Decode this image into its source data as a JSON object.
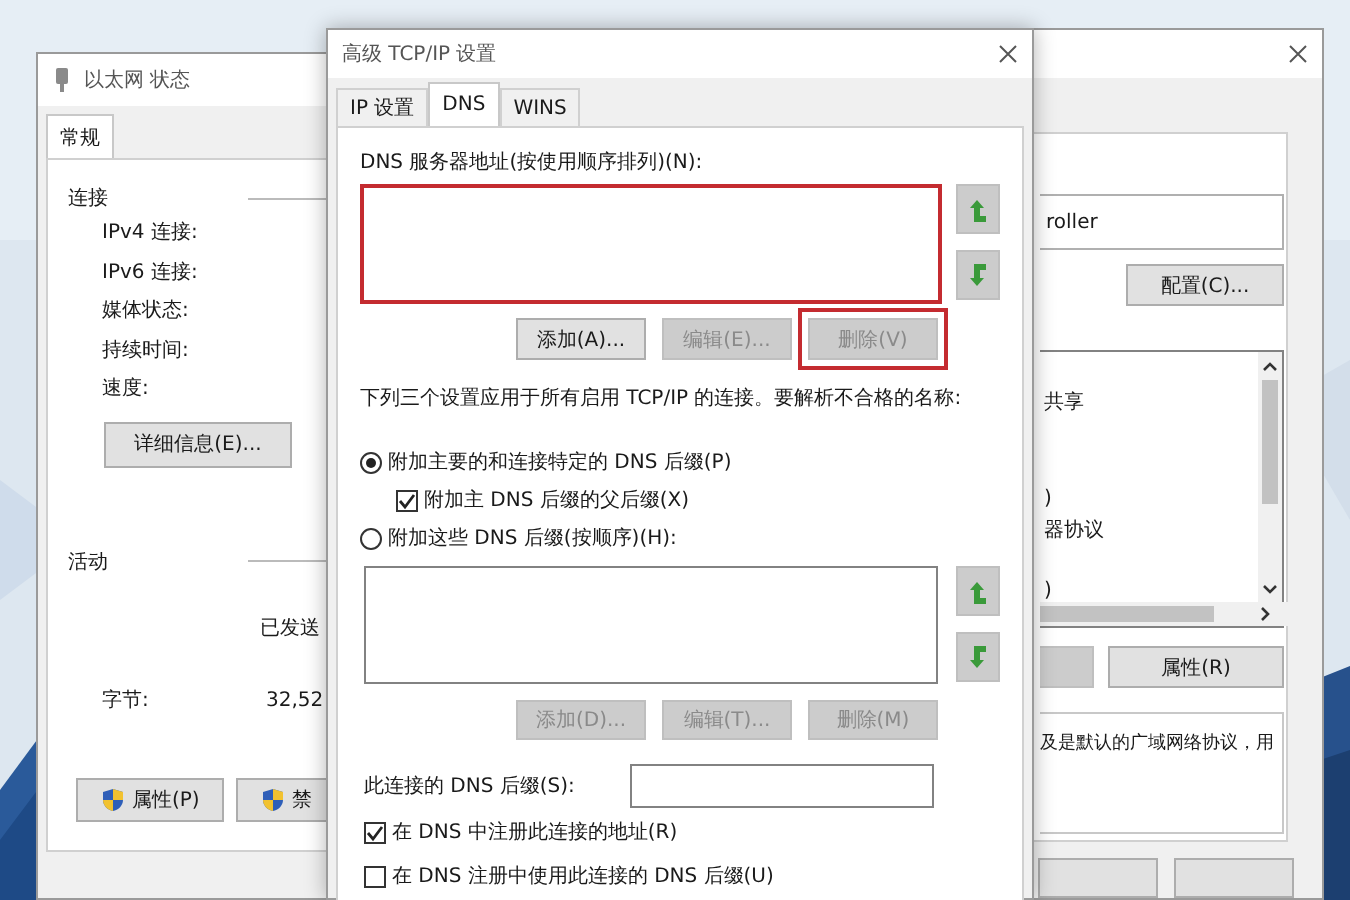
{
  "status_window": {
    "title": "以太网 状态",
    "tabs": [
      {
        "label": "常规",
        "selected": true
      }
    ],
    "connection": {
      "heading": "连接",
      "labels": [
        "IPv4 连接:",
        "IPv6 连接:",
        "媒体状态:",
        "持续时间:",
        "速度:"
      ],
      "details_button": "详细信息(E)..."
    },
    "activity": {
      "heading": "活动",
      "sent_label": "已发送",
      "bytes_label": "字节:",
      "bytes_sent": "32,52"
    },
    "buttons": [
      {
        "label": "属性(P)",
        "shield": true
      },
      {
        "label": "禁",
        "shield": true
      }
    ]
  },
  "tcpip_dialog": {
    "title": "高级 TCP/IP 设置",
    "tabs": [
      {
        "label": "IP 设置",
        "selected": false
      },
      {
        "label": "DNS",
        "selected": true
      },
      {
        "label": "WINS",
        "selected": false
      }
    ],
    "dns_servers": {
      "label": "DNS 服务器地址(按使用顺序排列)(N):",
      "highlighted": true,
      "buttons": [
        {
          "label": "添加(A)...",
          "disabled": false,
          "highlighted": false
        },
        {
          "label": "编辑(E)...",
          "disabled": true,
          "highlighted": false
        },
        {
          "label": "删除(V)",
          "disabled": true,
          "highlighted": true
        }
      ]
    },
    "description": "下列三个设置应用于所有启用 TCP/IP 的连接。要解析不合格的名称:",
    "options": [
      {
        "kind": "radio",
        "label": "附加主要的和连接特定的 DNS 后缀(P)",
        "selected": true
      },
      {
        "kind": "checkbox",
        "label": "附加主 DNS 后缀的父后缀(X)",
        "checked": true
      },
      {
        "kind": "radio",
        "label": "附加这些 DNS 后缀(按顺序)(H):",
        "selected": false
      }
    ],
    "suffix_list": {
      "buttons": [
        {
          "label": "添加(D)...",
          "disabled": true
        },
        {
          "label": "编辑(T)...",
          "disabled": true
        },
        {
          "label": "删除(M)",
          "disabled": true
        }
      ]
    },
    "suffix_field": {
      "label": "此连接的 DNS 后缀(S):"
    },
    "registration": [
      {
        "label": "在 DNS 中注册此连接的地址(R)",
        "checked": true
      },
      {
        "label": "在 DNS 注册中使用此连接的 DNS 后缀(U)",
        "checked": false
      }
    ]
  },
  "adapter_window": {
    "adapter_name": "roller",
    "configure_button": "配置(C)...",
    "items": [
      "共享",
      ")",
      "器协议",
      ")"
    ],
    "properties_button": "属性(R)",
    "description": "及是默认的广域网络协议，用"
  }
}
